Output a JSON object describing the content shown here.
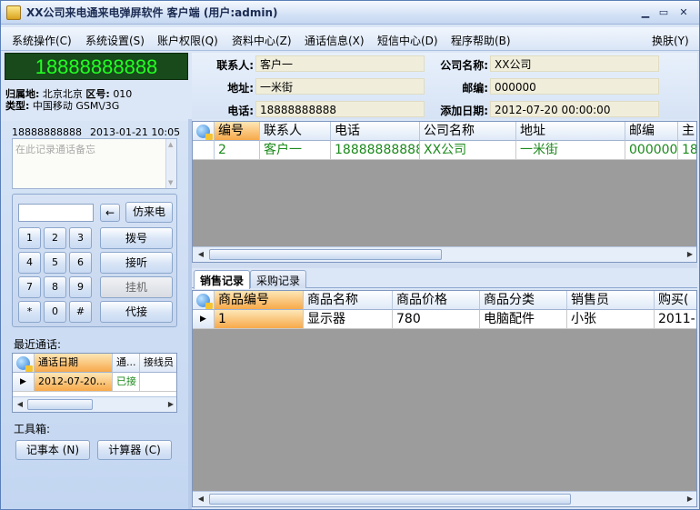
{
  "window": {
    "title": "XX公司来电通来电弹屏软件 客户端 (用户:admin)"
  },
  "menu": {
    "items": [
      {
        "label": "系统操作(C)"
      },
      {
        "label": "系统设置(S)"
      },
      {
        "label": "账户权限(Q)"
      },
      {
        "label": "资料中心(Z)"
      },
      {
        "label": "通话信息(X)"
      },
      {
        "label": "短信中心(D)"
      },
      {
        "label": "程序帮助(B)"
      }
    ],
    "right": "换肤(Y)"
  },
  "caller": {
    "number": "18888888888",
    "location_label": "归属地:",
    "location": "北京北京",
    "area_label": "区号:",
    "area_code": "010",
    "type_label": "类型:",
    "type": "中国移动 GSM\\/3G"
  },
  "info": {
    "contact_label": "联系人:",
    "contact": "客户一",
    "company_label": "公司名称:",
    "company": "XX公司",
    "address_label": "地址:",
    "address": "一米街",
    "zip_label": "邮编:",
    "zip": "000000",
    "phone_label": "电话:",
    "phone": "18888888888",
    "added_label": "添加日期:",
    "added": "2012-07-20 00:00:00"
  },
  "call": {
    "number": "18888888888",
    "datetime": "2013-01-21 10:05",
    "memo_placeholder": "在此记录通话备忘"
  },
  "keypad": {
    "keys": [
      "1",
      "2",
      "3",
      "4",
      "5",
      "6",
      "7",
      "8",
      "9",
      "*",
      "0",
      "#"
    ],
    "backspace": "←",
    "simulate": "仿来电",
    "dial": "拨号",
    "answer": "接听",
    "hangup": "挂机",
    "pickup": "代接"
  },
  "recent": {
    "label": "最近通话:",
    "headers": [
      "通话日期",
      "通...",
      "接线员"
    ],
    "rows": [
      [
        "2012-07-20...",
        "已接",
        ""
      ]
    ]
  },
  "tools": {
    "label": "工具箱:",
    "notepad": "记事本 (N)",
    "calculator": "计算器 (C)"
  },
  "customers": {
    "headers": [
      "编号",
      "联系人",
      "电话",
      "公司名称",
      "地址",
      "邮编",
      "主"
    ],
    "rows": [
      [
        "2",
        "客户一",
        "18888888888",
        "XX公司",
        "一米街",
        "000000",
        "18"
      ]
    ]
  },
  "tabs": {
    "sales": "销售记录",
    "purchase": "采购记录"
  },
  "sales": {
    "headers": [
      "商品编号",
      "商品名称",
      "商品价格",
      "商品分类",
      "销售员",
      "购买("
    ],
    "rows": [
      [
        "1",
        "显示器",
        "780",
        "电脑配件",
        "小张",
        "2011-"
      ]
    ]
  },
  "colors": {
    "phone_display_bg": "#184a1b",
    "phone_display_text": "#22ff22",
    "selected": "#f7a94a",
    "green_text": "#1c8a1c"
  }
}
